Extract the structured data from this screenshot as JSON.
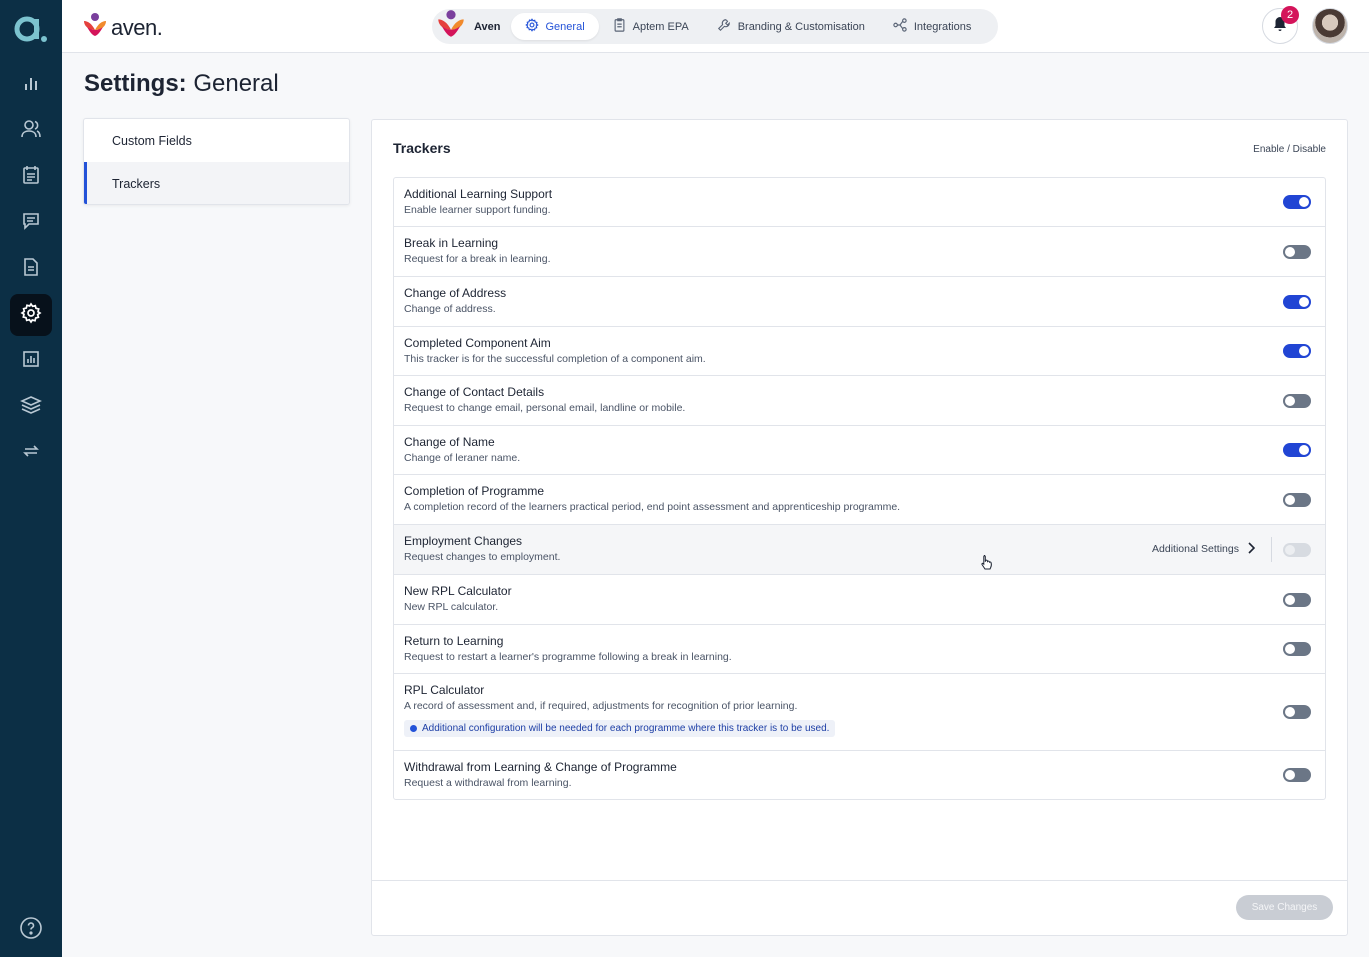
{
  "brand": {
    "name": "aven."
  },
  "topnav": {
    "org_name": "Aven",
    "tabs": [
      {
        "label": "General",
        "icon": "gear-icon",
        "active": true
      },
      {
        "label": "Aptem EPA",
        "icon": "clipboard-icon",
        "active": false
      },
      {
        "label": "Branding & Customisation",
        "icon": "wrench-icon",
        "active": false
      },
      {
        "label": "Integrations",
        "icon": "integrations-icon",
        "active": false
      }
    ]
  },
  "notifications": {
    "count": "2"
  },
  "page": {
    "title_bold": "Settings:",
    "title_rest": " General"
  },
  "sidetabs": [
    {
      "label": "Custom Fields",
      "active": false
    },
    {
      "label": "Trackers",
      "active": true
    }
  ],
  "trackers": {
    "title": "Trackers",
    "enable_label": "Enable / Disable",
    "additional_settings_label": "Additional Settings",
    "items": [
      {
        "title": "Additional Learning Support",
        "desc": "Enable learner support funding.",
        "state": "on"
      },
      {
        "title": "Break in Learning",
        "desc": "Request for a break in learning.",
        "state": "off"
      },
      {
        "title": "Change of Address",
        "desc": "Change of address.",
        "state": "on"
      },
      {
        "title": "Completed Component Aim",
        "desc": "This tracker is for the successful completion of a component aim.",
        "state": "on"
      },
      {
        "title": "Change of Contact Details",
        "desc": "Request to change email, personal email, landline or mobile.",
        "state": "off"
      },
      {
        "title": "Change of Name",
        "desc": "Change of leraner name.",
        "state": "on"
      },
      {
        "title": "Completion of Programme",
        "desc": "A completion record of the learners practical period, end point assessment and apprenticeship programme.",
        "state": "off"
      },
      {
        "title": "Employment Changes",
        "desc": "Request changes to employment.",
        "state": "disabled"
      },
      {
        "title": "New RPL Calculator",
        "desc": "New RPL calculator.",
        "state": "off"
      },
      {
        "title": "Return to Learning",
        "desc": "Request to restart a learner's programme following a break in learning.",
        "state": "off"
      },
      {
        "title": "RPL Calculator",
        "desc": "A record of assessment and, if required, adjustments for recognition of prior learning.",
        "note": "Additional configuration will be needed for each programme where this tracker is to be used.",
        "state": "off"
      },
      {
        "title": "Withdrawal from Learning & Change of Programme",
        "desc": "Request a withdrawal from learning.",
        "state": "off"
      }
    ]
  },
  "footer": {
    "save_label": "Save Changes"
  },
  "colors": {
    "rail": "#0c2f45",
    "accent": "#2352d8",
    "toggle_on": "#2145d4",
    "toggle_off": "#6b7686"
  }
}
